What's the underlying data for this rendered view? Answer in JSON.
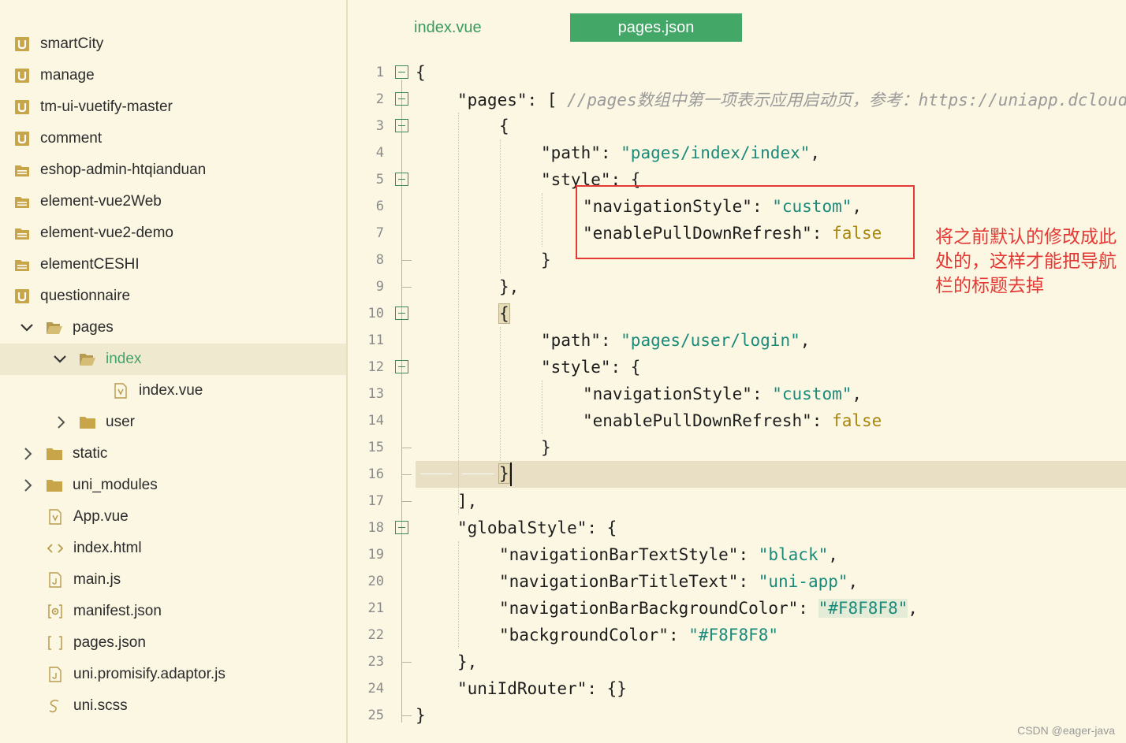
{
  "sidebar": {
    "items": [
      {
        "label": "smartCity",
        "icon": "uni-project-icon"
      },
      {
        "label": "manage",
        "icon": "uni-project-icon"
      },
      {
        "label": "tm-ui-vuetify-master",
        "icon": "uni-project-icon"
      },
      {
        "label": "comment",
        "icon": "uni-project-icon"
      },
      {
        "label": "eshop-admin-htqianduan",
        "icon": "folder-project-icon"
      },
      {
        "label": "element-vue2Web",
        "icon": "folder-project-icon"
      },
      {
        "label": "element-vue2-demo",
        "icon": "folder-project-icon"
      },
      {
        "label": "elementCESHI",
        "icon": "folder-project-icon"
      },
      {
        "label": "questionnaire",
        "icon": "uni-project-icon"
      },
      {
        "label": "pages",
        "icon": "folder-open-icon"
      },
      {
        "label": "index",
        "icon": "folder-open-icon"
      },
      {
        "label": "index.vue",
        "icon": "vue-file-icon"
      },
      {
        "label": "user",
        "icon": "folder-icon"
      },
      {
        "label": "static",
        "icon": "folder-icon"
      },
      {
        "label": "uni_modules",
        "icon": "folder-icon"
      },
      {
        "label": "App.vue",
        "icon": "vue-file-icon"
      },
      {
        "label": "index.html",
        "icon": "html-file-icon"
      },
      {
        "label": "main.js",
        "icon": "js-file-icon"
      },
      {
        "label": "manifest.json",
        "icon": "manifest-file-icon"
      },
      {
        "label": "pages.json",
        "icon": "json-file-icon"
      },
      {
        "label": "uni.promisify.adaptor.js",
        "icon": "js-file-icon"
      },
      {
        "label": "uni.scss",
        "icon": "scss-file-icon"
      }
    ]
  },
  "tabs": [
    {
      "label": "index.vue",
      "active": false
    },
    {
      "label": "pages.json",
      "active": true
    }
  ],
  "code": {
    "line_numbers": [
      "1",
      "2",
      "3",
      "4",
      "5",
      "6",
      "7",
      "8",
      "9",
      "10",
      "11",
      "12",
      "13",
      "14",
      "15",
      "16",
      "17",
      "18",
      "19",
      "20",
      "21",
      "22",
      "23",
      "24",
      "25"
    ],
    "current_line": "16",
    "tokens": {
      "l1_open": "{",
      "l2_key": "\"pages\"",
      "l2_punct": ": [ ",
      "l2_comment": "//pages数组中第一项表示应用启动页，参考：https://uniapp.dcloud.io/collocation/pages",
      "l3": "{",
      "l4_key": "\"path\"",
      "l4_val": "\"pages/index/index\"",
      "l5_key": "\"style\"",
      "l5_punct": ": {",
      "l6_key": "\"navigationStyle\"",
      "l6_val": "\"custom\"",
      "l7_key": "\"enablePullDownRefresh\"",
      "l7_val": "false",
      "l8": "}",
      "l9": "},",
      "l10": "{",
      "l11_key": "\"path\"",
      "l11_val": "\"pages/user/login\"",
      "l12_key": "\"style\"",
      "l12_punct": ": {",
      "l13_key": "\"navigationStyle\"",
      "l13_val": "\"custom\"",
      "l14_key": "\"enablePullDownRefresh\"",
      "l14_val": "false",
      "l15": "}",
      "l16": "}",
      "l17": "],",
      "l18_key": "\"globalStyle\"",
      "l18_punct": ": {",
      "l19_key": "\"navigationBarTextStyle\"",
      "l19_val": "\"black\"",
      "l20_key": "\"navigationBarTitleText\"",
      "l20_val": "\"uni-app\"",
      "l21_key": "\"navigationBarBackgroundColor\"",
      "l21_val": "\"#F8F8F8\"",
      "l22_key": "\"backgroundColor\"",
      "l22_val": "\"#F8F8F8\"",
      "l23": "},",
      "l24_key": "\"uniIdRouter\"",
      "l24_punct": ": {}",
      "l25": "}"
    }
  },
  "annotation": {
    "text": "将之前默认的修改成此处的，这样才能把导航栏的标题去掉",
    "color": "#e53935"
  },
  "watermark": "CSDN @eager-java",
  "colors": {
    "background": "#fbf7e3",
    "accent": "#43a867",
    "string": "#1a8a7a",
    "boolean": "#a8850c"
  }
}
